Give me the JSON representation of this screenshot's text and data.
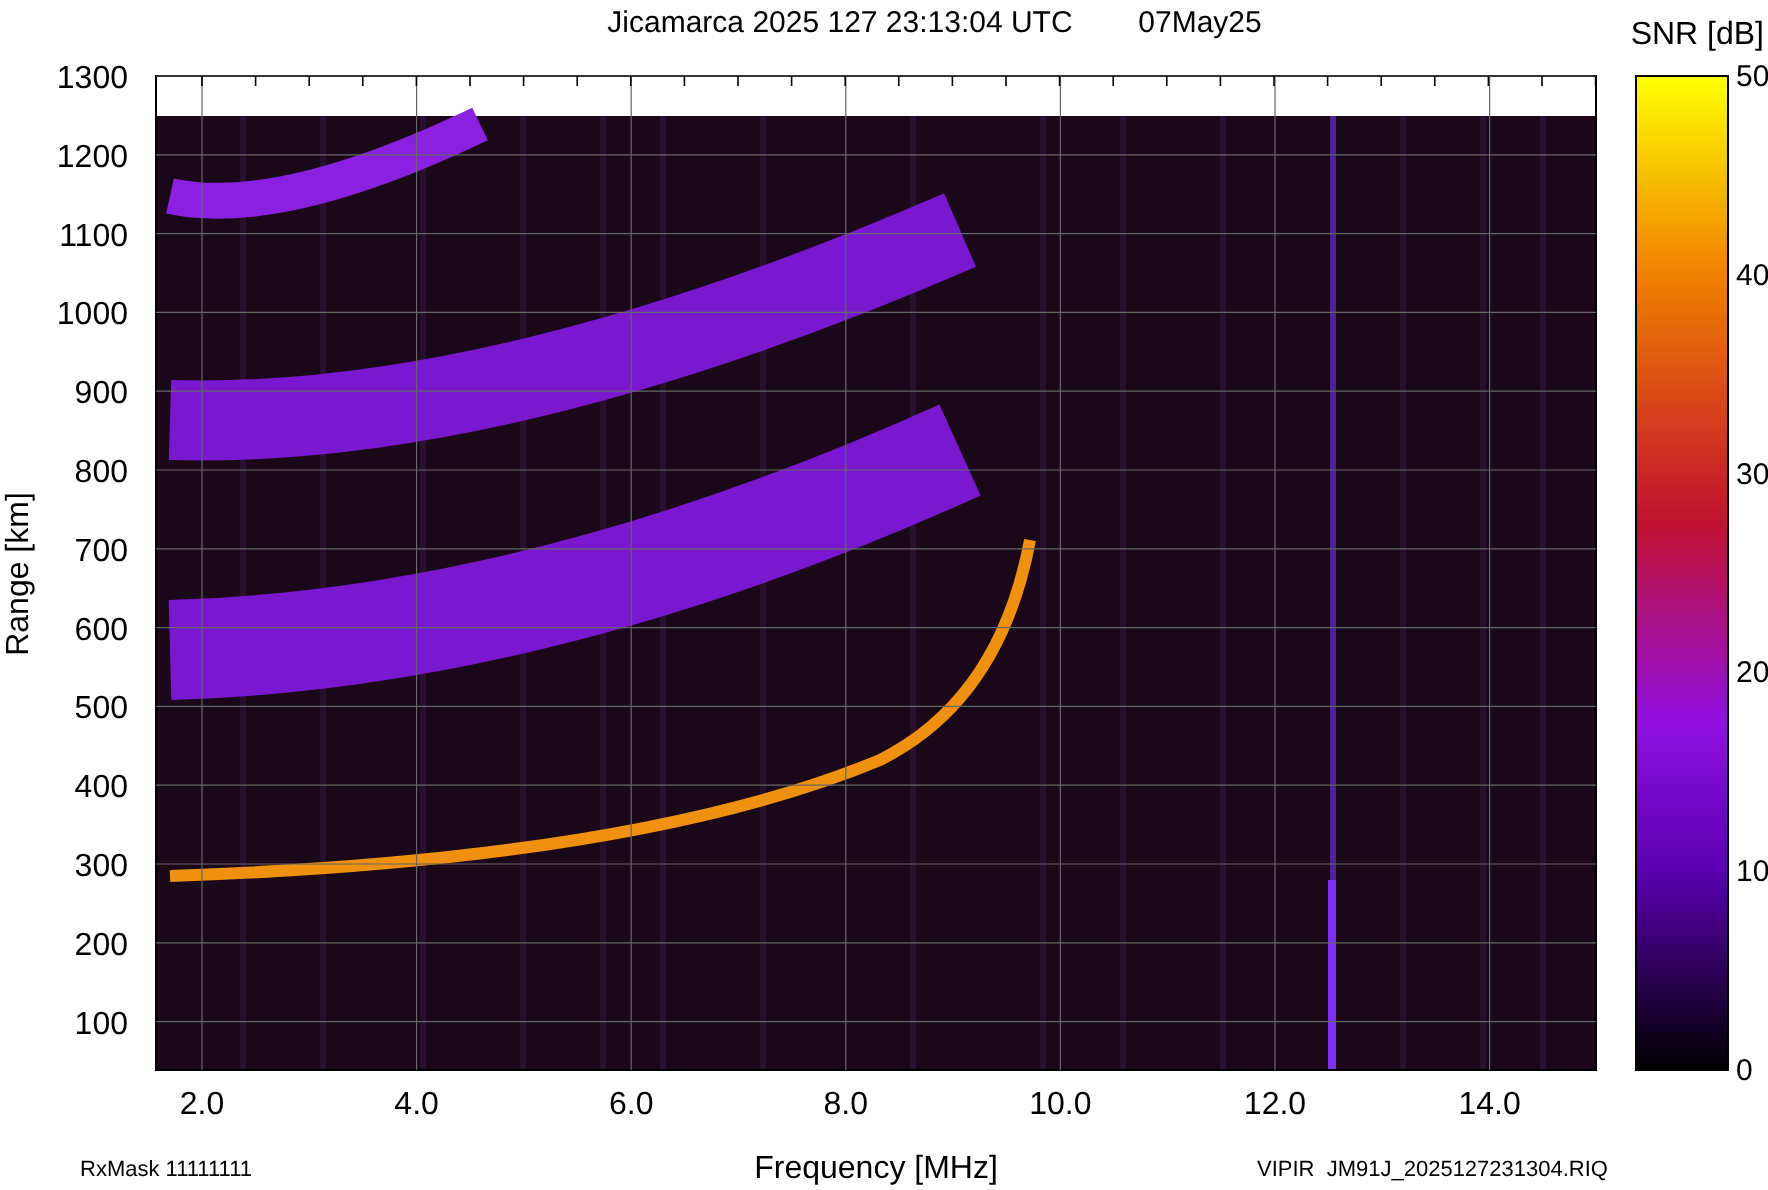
{
  "title": "Jicamarca 2025 127 23:13:04 UTC",
  "date": "07May25",
  "plot": {
    "y_axis": {
      "label": "Range [km]",
      "ticks": [
        "1300",
        "1200",
        "1100",
        "1000",
        "900",
        "800",
        "700",
        "600",
        "500",
        "400",
        "300",
        "200",
        "100"
      ]
    },
    "x_axis": {
      "label": "Frequency [MHz]",
      "ticks": [
        "2.0",
        "4.0",
        "6.0",
        "8.0",
        "10.0",
        "12.0",
        "14.0"
      ]
    }
  },
  "colorbar": {
    "label": "SNR [dB]",
    "ticks": [
      "50",
      "40",
      "30",
      "20",
      "10",
      "0"
    ]
  },
  "footer_left": "RxMask 11111111",
  "footer_right": "VIPIR  JM91J_2025127231304.RIQ"
}
